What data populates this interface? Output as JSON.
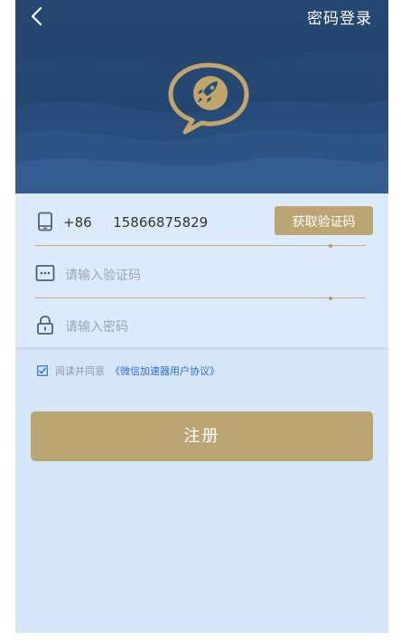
{
  "header": {
    "back_icon": "chevron-left-icon",
    "password_login_label": "密码登录",
    "logo_icon": "rocket-chat-bubble-icon"
  },
  "form": {
    "phone": {
      "icon": "mobile-phone-icon",
      "country_code": "+86",
      "number": "15866875829",
      "get_code_label": "获取验证码"
    },
    "code": {
      "icon": "dots-message-icon",
      "placeholder": "请输入验证码"
    },
    "password": {
      "icon": "lock-icon",
      "placeholder": "请输入密码"
    }
  },
  "agreement": {
    "checked": true,
    "prefix": "阅读并同意",
    "link": "《微信加速器用户协议》"
  },
  "register_label": "注册",
  "colors": {
    "header_bg": "#294d79",
    "accent_gold": "#bba573",
    "form_bg": "#dcebfb",
    "page_bg": "#d5e6f8",
    "link_blue": "#2d6fd2"
  }
}
